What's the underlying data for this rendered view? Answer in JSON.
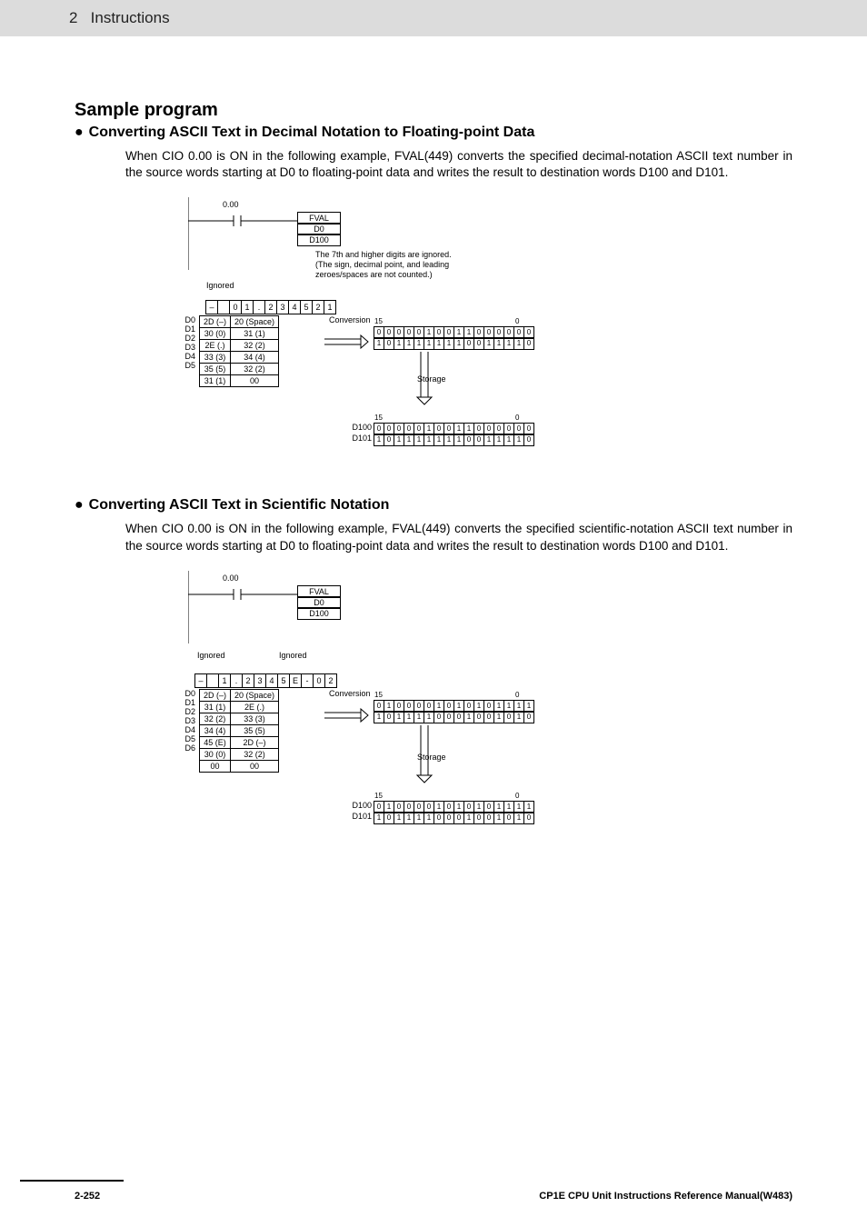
{
  "header": {
    "chapter_num": "2",
    "chapter_title": "Instructions"
  },
  "section": {
    "title": "Sample program",
    "sub1_title": "Converting ASCII Text in Decimal Notation to Floating-point Data",
    "sub1_body": "When CIO 0.00 is ON in the following example, FVAL(449) converts the specified decimal-notation ASCII text number in the source words starting at D0 to floating-point data and writes the result to destination words D100 and D101.",
    "sub2_title": "Converting ASCII Text in Scientific Notation",
    "sub2_body": "When CIO 0.00 is ON in the following example, FVAL(449) converts the specified scientific-notation ASCII text number in the source words starting at D0 to floating-point data and writes the result to destination words D100 and D101."
  },
  "diagram1": {
    "contact": "0.00",
    "instr": [
      "FVAL",
      "D0",
      "D100"
    ],
    "ignored": "Ignored",
    "note": "The 7th and higher digits are ignored.\n(The sign, decimal point, and leading\nzeroes/spaces are not counted.)",
    "chars": [
      "–",
      " ",
      "0",
      "1",
      ".",
      "2",
      "3",
      "4",
      "5",
      "2",
      "1"
    ],
    "rows": [
      "D0",
      "D1",
      "D2",
      "D3",
      "D4",
      "D5"
    ],
    "cells": [
      [
        "2D (–)",
        "20 (Space)"
      ],
      [
        "30 (0)",
        "31 (1)"
      ],
      [
        "2E (.)",
        "32 (2)"
      ],
      [
        "33 (3)",
        "34 (4)"
      ],
      [
        "35 (5)",
        "32 (2)"
      ],
      [
        "31 (1)",
        "00"
      ]
    ],
    "conversion": "Conversion",
    "storage": "Storage",
    "bit_hi": "15",
    "bit_lo": "0",
    "bits_a": "0000010011000000",
    "bits_b": "1011111110011110",
    "dest_rows": [
      "D100",
      "D101"
    ],
    "bits_c": "0000010011000000",
    "bits_d": "1011111110011110"
  },
  "diagram2": {
    "contact": "0.00",
    "instr": [
      "FVAL",
      "D0",
      "D100"
    ],
    "ignored1": "Ignored",
    "ignored2": "Ignored",
    "chars": [
      "–",
      " ",
      "1",
      ".",
      "2",
      "3",
      "4",
      "5",
      "E",
      "-",
      "0",
      "2"
    ],
    "rows": [
      "D0",
      "D1",
      "D2",
      "D3",
      "D4",
      "D5",
      "D6"
    ],
    "cells": [
      [
        "2D (–)",
        "20 (Space)"
      ],
      [
        "31 (1)",
        "2E (.)"
      ],
      [
        "32 (2)",
        "33 (3)"
      ],
      [
        "34 (4)",
        "35 (5)"
      ],
      [
        "45 (E)",
        "2D (–)"
      ],
      [
        "30 (0)",
        "32 (2)"
      ],
      [
        "00",
        "00"
      ]
    ],
    "conversion": "Conversion",
    "storage": "Storage",
    "bit_hi": "15",
    "bit_lo": "0",
    "bits_a": "0100001010101111",
    "bits_b": "1011110001001010",
    "dest_rows": [
      "D100",
      "D101"
    ],
    "bits_c": "0100001010101111",
    "bits_d": "1011110001001010"
  },
  "footer": {
    "page": "2-252",
    "manual": "CP1E CPU Unit Instructions Reference Manual(W483)"
  }
}
